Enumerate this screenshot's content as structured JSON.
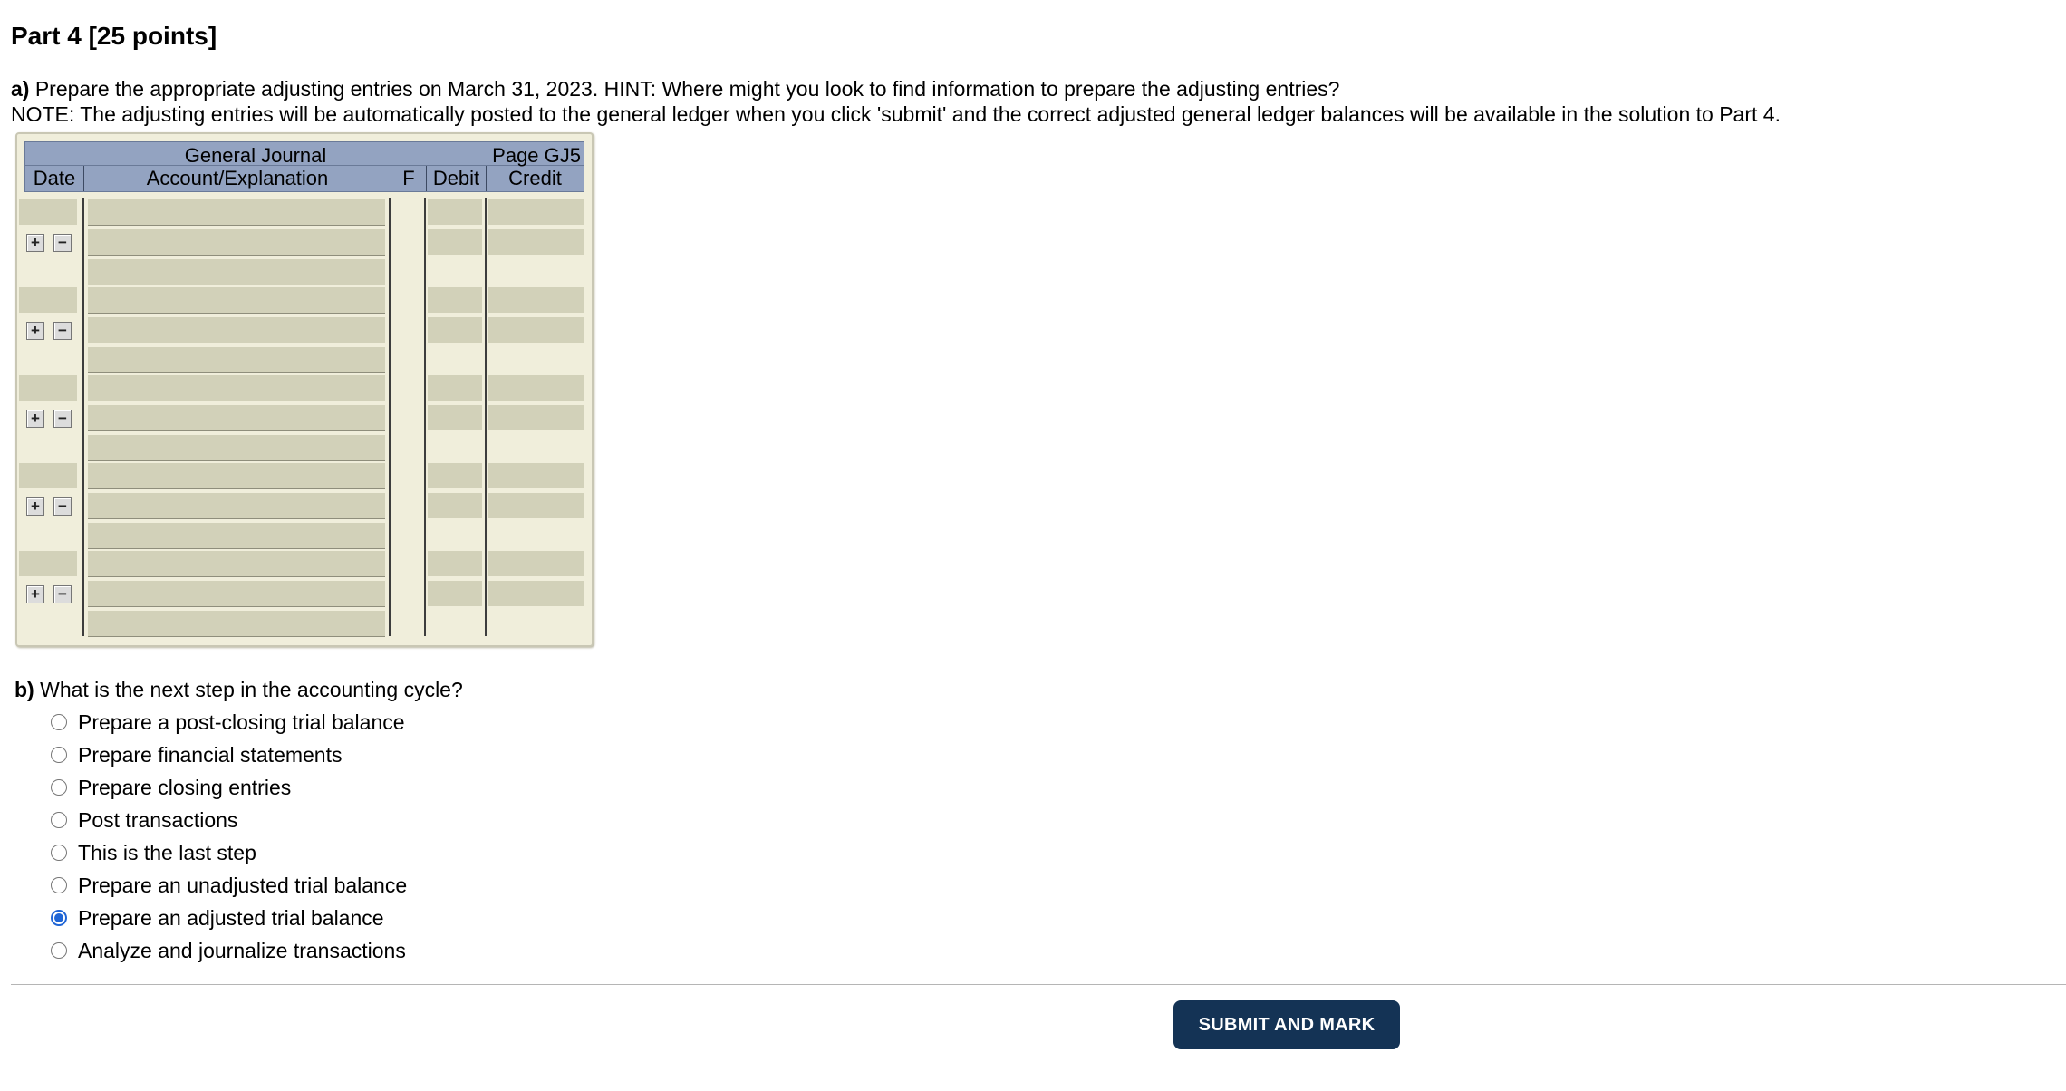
{
  "title": "Part 4 [25 points]",
  "part_a": {
    "label": "a)",
    "text": " Prepare the appropriate adjusting entries on March 31, 2023. HINT: Where might you look to find information to prepare the adjusting entries?",
    "note": "NOTE: The adjusting entries will be automatically posted to the general ledger when you click 'submit' and the correct adjusted general ledger balances will be available in the solution to Part 4."
  },
  "journal": {
    "title": "General Journal",
    "page": "Page GJ5",
    "columns": [
      "Date",
      "Account/Explanation",
      "F",
      "Debit",
      "Credit"
    ],
    "add_symbol": "+",
    "remove_symbol": "−",
    "entry_count": 5
  },
  "part_b": {
    "label": "b)",
    "question": " What is the next step in the accounting cycle?",
    "options": [
      "Prepare a post-closing trial balance",
      "Prepare financial statements",
      "Prepare closing entries",
      "Post transactions",
      "This is the last step",
      "Prepare an unadjusted trial balance",
      "Prepare an adjusted trial balance",
      "Analyze and journalize transactions"
    ],
    "selected_index": 6
  },
  "submit_label": "SUBMIT AND MARK"
}
